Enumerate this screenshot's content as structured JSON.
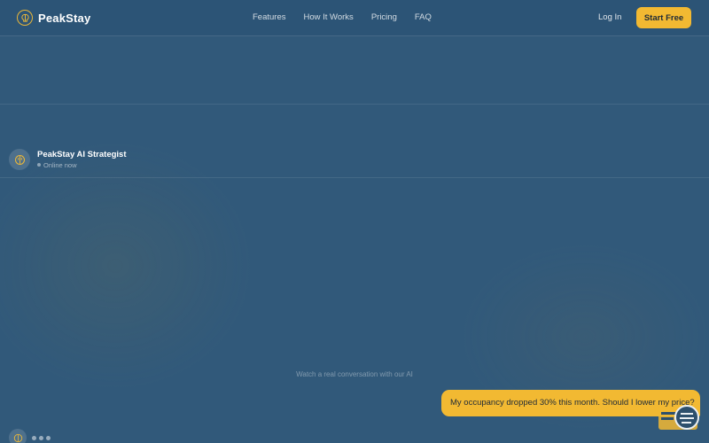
{
  "colors": {
    "accent": "#f2b932",
    "background": "#31597a",
    "text": "#ffffff"
  },
  "brand": {
    "name": "PeakStay",
    "logo_icon": "brain-icon"
  },
  "nav": {
    "links": [
      "Features",
      "How It Works",
      "Pricing",
      "FAQ"
    ],
    "login_label": "Log In",
    "cta_label": "Start Free"
  },
  "chat": {
    "agent_name": "PeakStay AI Strategist",
    "agent_status": "Online now",
    "caption": "Watch a real conversation with our AI",
    "user_message": "My occupancy dropped 30% this month. Should I lower my price?"
  },
  "icons": {
    "launcher": "chat-launcher-icon"
  }
}
